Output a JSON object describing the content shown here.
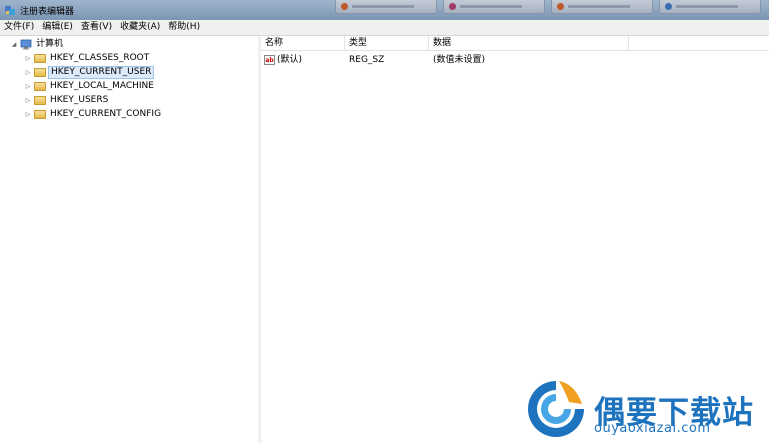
{
  "window": {
    "title": "注册表编辑器"
  },
  "menu": [
    "文件(F)",
    "编辑(E)",
    "查看(V)",
    "收藏夹(A)",
    "帮助(H)"
  ],
  "tree": {
    "root": "计算机",
    "nodes": [
      "HKEY_CLASSES_ROOT",
      "HKEY_CURRENT_USER",
      "HKEY_LOCAL_MACHINE",
      "HKEY_USERS",
      "HKEY_CURRENT_CONFIG"
    ],
    "selected": "HKEY_CURRENT_USER"
  },
  "list": {
    "columns": [
      "名称",
      "类型",
      "数据"
    ],
    "rows": [
      {
        "name": "(默认)",
        "type": "REG_SZ",
        "data": "(数值未设置)"
      }
    ]
  },
  "watermark": {
    "brand": "偶要下载站",
    "url": "ouyaoxiazai.com"
  },
  "colors": {
    "accent": "#1e73be",
    "selection": "#dceaf9"
  },
  "icons": {
    "app": "registry-editor-icon",
    "computer": "computer-icon",
    "key": "folder-icon",
    "value": "string-value-icon"
  }
}
